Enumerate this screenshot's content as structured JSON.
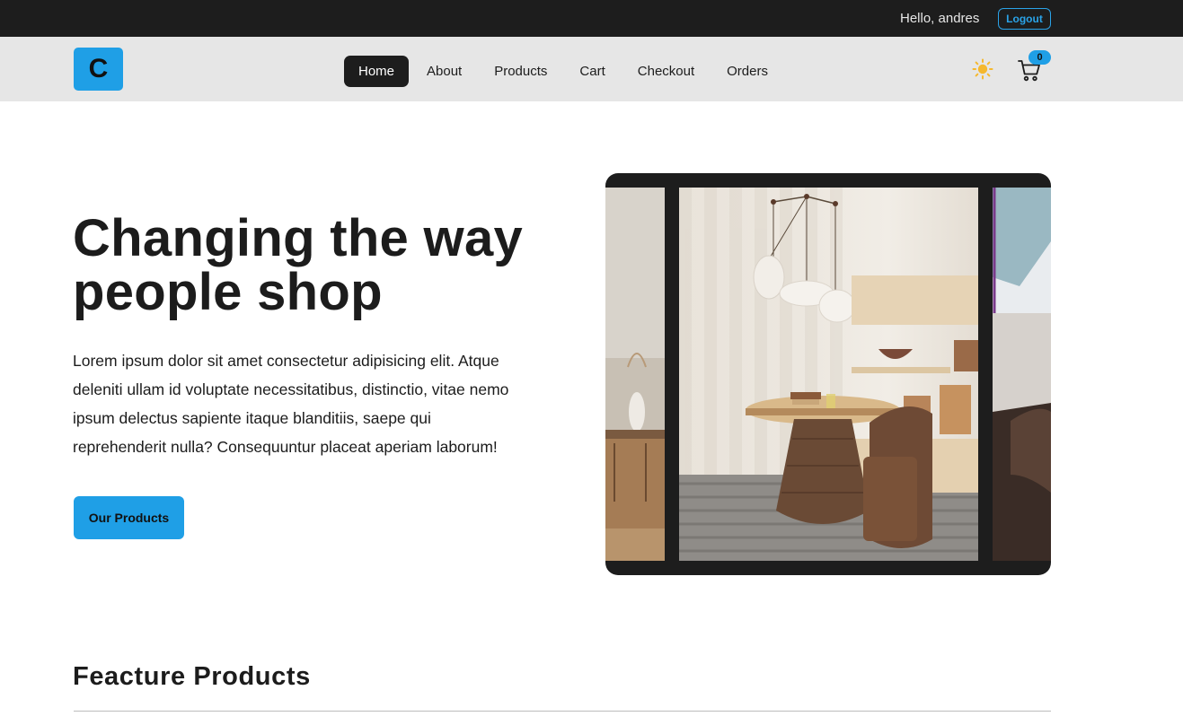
{
  "topbar": {
    "greeting": "Hello, andres",
    "logout_label": "Logout"
  },
  "navbar": {
    "logo_letter": "C",
    "links": [
      {
        "label": "Home",
        "active": true
      },
      {
        "label": "About",
        "active": false
      },
      {
        "label": "Products",
        "active": false
      },
      {
        "label": "Cart",
        "active": false
      },
      {
        "label": "Checkout",
        "active": false
      },
      {
        "label": "Orders",
        "active": false
      }
    ],
    "theme_icon": "sun-icon",
    "cart_icon": "cart-icon",
    "cart_count": "0"
  },
  "hero": {
    "title": "Changing the way people shop",
    "text": "Lorem ipsum dolor sit amet consectetur adipisicing elit. Atque deleniti ullam id voluptate necessitatibus, distinctio, vitae nemo ipsum delectus sapiente itaque blanditiis, saepe qui reprehenderit nulla? Consequuntur placeat aperiam laborum!",
    "cta_label": "Our Products"
  },
  "featured": {
    "title": "Feacture Products"
  },
  "colors": {
    "accent": "#1f9fe6",
    "dark": "#1d1d1d",
    "navbar_bg": "#e6e6e6"
  }
}
